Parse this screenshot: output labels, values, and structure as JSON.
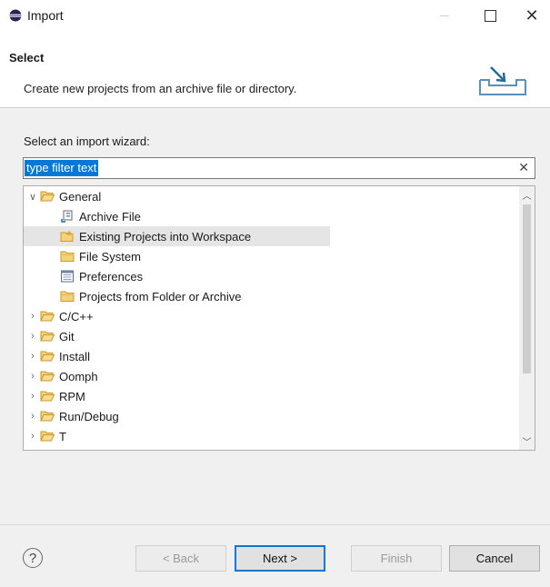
{
  "window": {
    "title": "Import"
  },
  "header": {
    "title": "Select",
    "description": "Create new projects from an archive file or directory."
  },
  "body": {
    "label": "Select an import wizard:",
    "filter": {
      "value": "type filter text"
    }
  },
  "tree": {
    "items": [
      {
        "label": "General",
        "expanded": true,
        "icon": "folder-open-icon"
      },
      {
        "label": "Archive File",
        "icon": "archive-icon"
      },
      {
        "label": "Existing Projects into Workspace",
        "icon": "project-folder-icon",
        "selected": true
      },
      {
        "label": "File System",
        "icon": "folder-icon"
      },
      {
        "label": "Preferences",
        "icon": "preferences-icon"
      },
      {
        "label": "Projects from Folder or Archive",
        "icon": "folder-icon"
      },
      {
        "label": "C/C++",
        "expanded": false,
        "icon": "folder-open-icon"
      },
      {
        "label": "Git",
        "expanded": false,
        "icon": "folder-open-icon"
      },
      {
        "label": "Install",
        "expanded": false,
        "icon": "folder-open-icon"
      },
      {
        "label": "Oomph",
        "expanded": false,
        "icon": "folder-open-icon"
      },
      {
        "label": "RPM",
        "expanded": false,
        "icon": "folder-open-icon"
      },
      {
        "label": "Run/Debug",
        "expanded": false,
        "icon": "folder-open-icon"
      },
      {
        "label": "T",
        "expanded": false,
        "icon": "folder-open-icon"
      }
    ]
  },
  "buttons": {
    "help": "?",
    "back": "< Back",
    "next": "Next >",
    "finish": "Finish",
    "cancel": "Cancel"
  },
  "colors": {
    "accent": "#0078d7",
    "folder": "#e8b84a",
    "selection": "#e5e5e5"
  }
}
